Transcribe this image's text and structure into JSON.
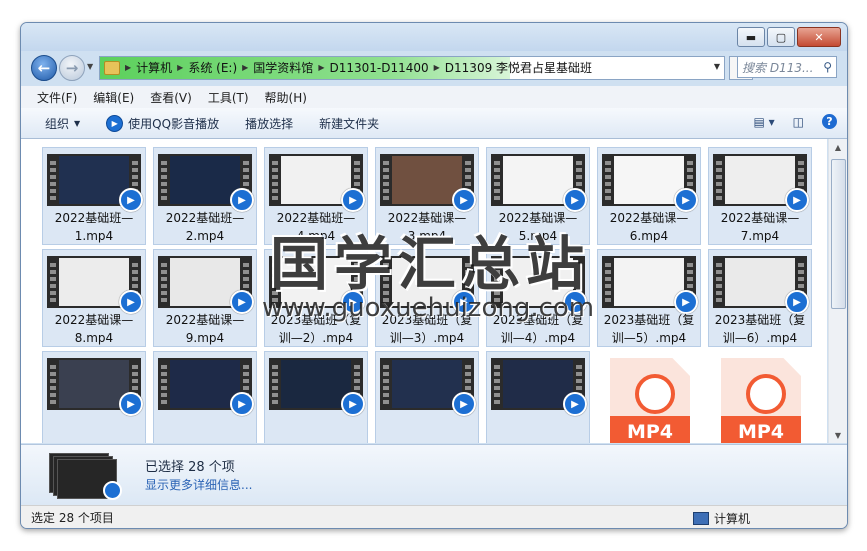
{
  "window": {
    "minimize_label": "▬",
    "maximize_label": "▢",
    "close_label": "✕"
  },
  "address": {
    "crumbs": [
      "计算机",
      "系统 (E:)",
      "国学资料馆",
      "D11301-D11400",
      "D11309 李悦君占星基础班"
    ]
  },
  "search": {
    "placeholder": "搜索 D113..."
  },
  "menu": [
    "文件(F)",
    "编辑(E)",
    "查看(V)",
    "工具(T)",
    "帮助(H)"
  ],
  "toolbar": {
    "organize": "组织",
    "play_qq": "使用QQ影音播放",
    "play_select": "播放选择",
    "new_folder": "新建文件夹"
  },
  "files": [
    {
      "name": "2022基础班—1.mp4",
      "kind": "video"
    },
    {
      "name": "2022基础班—2.mp4",
      "kind": "video"
    },
    {
      "name": "2022基础班—4.mp4",
      "kind": "video"
    },
    {
      "name": "2022基础课—3.mp4",
      "kind": "video"
    },
    {
      "name": "2022基础课—5.mp4",
      "kind": "video"
    },
    {
      "name": "2022基础课—6.mp4",
      "kind": "video"
    },
    {
      "name": "2022基础课—7.mp4",
      "kind": "video"
    },
    {
      "name": "2022基础课—8.mp4",
      "kind": "video"
    },
    {
      "name": "2022基础课—9.mp4",
      "kind": "video"
    },
    {
      "name": "2023基础班（复训—2）.mp4",
      "kind": "video"
    },
    {
      "name": "2023基础班（复训—3）.mp4",
      "kind": "video"
    },
    {
      "name": "2023基础班（复训—4）.mp4",
      "kind": "video"
    },
    {
      "name": "2023基础班（复训—5）.mp4",
      "kind": "video"
    },
    {
      "name": "2023基础班（复训—6）.mp4",
      "kind": "video"
    },
    {
      "name": "",
      "kind": "video"
    },
    {
      "name": "",
      "kind": "video"
    },
    {
      "name": "",
      "kind": "video"
    },
    {
      "name": "",
      "kind": "video"
    },
    {
      "name": "",
      "kind": "video"
    },
    {
      "name": "",
      "kind": "mp4",
      "badge": "MP4"
    },
    {
      "name": "",
      "kind": "mp4",
      "badge": "MP4"
    }
  ],
  "details": {
    "selected": "已选择 28 个项",
    "more": "显示更多详细信息..."
  },
  "status": {
    "left": "选定 28 个项目",
    "right": "计算机"
  },
  "watermark": {
    "title": "国学汇总站",
    "url": "www.guoxuehuizong.com"
  },
  "colors": {
    "accent": "#1c6fd3",
    "mp4": "#f25b33",
    "address_progress": "#5cd05c"
  }
}
